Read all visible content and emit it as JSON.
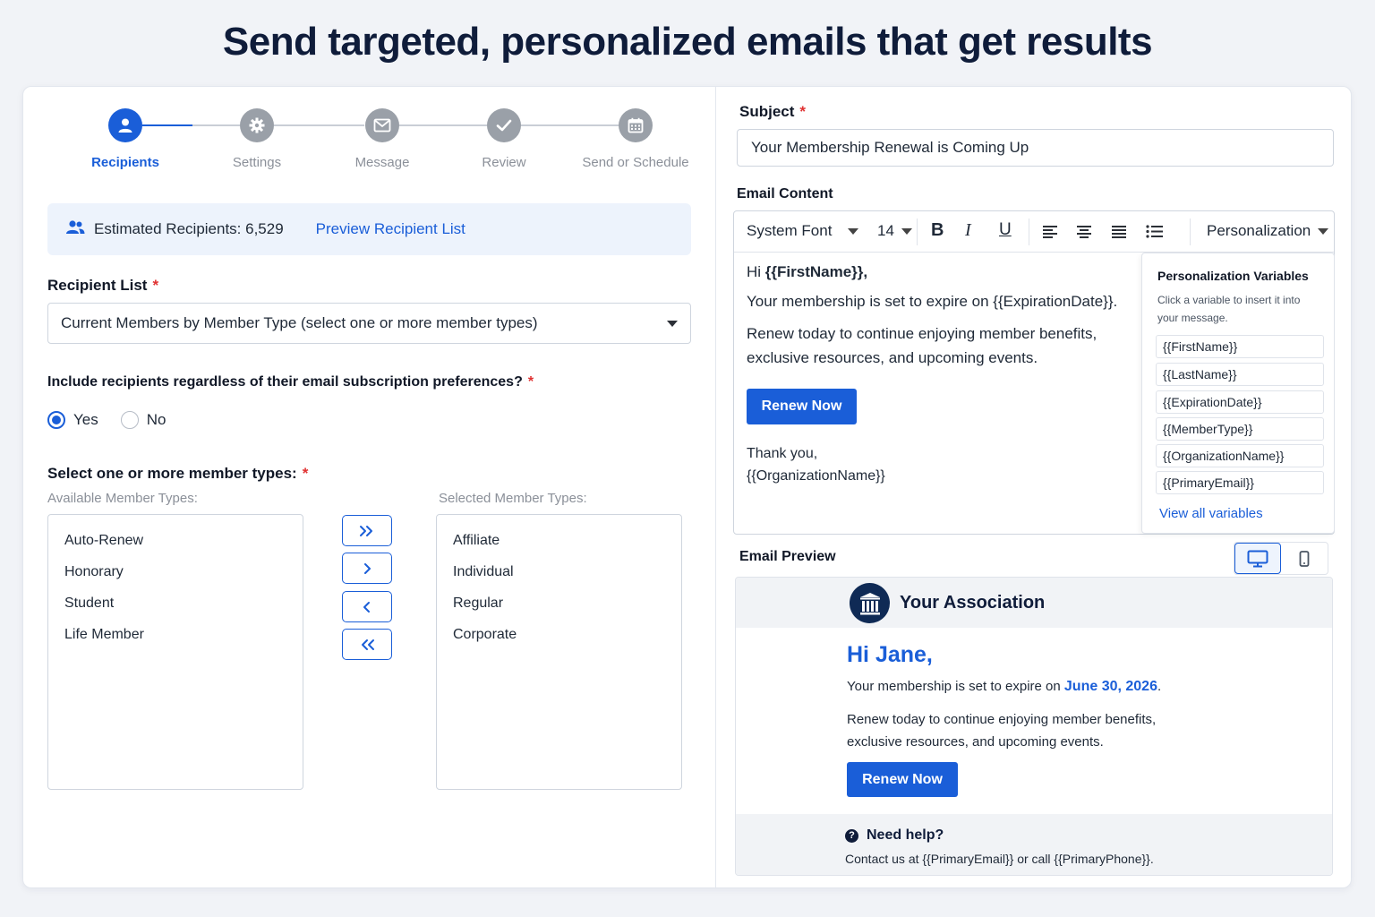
{
  "headline": "Send targeted, personalized emails that get results",
  "stepper": {
    "steps": [
      {
        "label": "Recipients",
        "icon": "user-icon",
        "active": true
      },
      {
        "label": "Settings",
        "icon": "gear-icon",
        "active": false
      },
      {
        "label": "Message",
        "icon": "envelope-icon",
        "active": false
      },
      {
        "label": "Review",
        "icon": "check-icon",
        "active": false
      },
      {
        "label": "Send or Schedule",
        "icon": "calendar-icon",
        "active": false
      }
    ]
  },
  "recipients": {
    "estimated": "Estimated Recipients: 6,529",
    "preview_link": "Preview Recipient List",
    "list_label": "Recipient List",
    "list_value": "Current Members by Member Type (select one or more member types)",
    "subscription_question": "Include recipients regardless of their email subscription preferences?",
    "yes_label": "Yes",
    "no_label": "No",
    "selected_option": "Yes",
    "member_types_label": "Select one or more member types:",
    "available_label": "Available Member Types:",
    "selected_label": "Selected Member Types:",
    "available": [
      "Auto-Renew",
      "Honorary",
      "Student",
      "Life Member"
    ],
    "selected": [
      "Affiliate",
      "Individual",
      "Regular",
      "Corporate"
    ]
  },
  "required_marker": "*",
  "subject": {
    "label": "Subject",
    "value": "Your Membership Renewal is Coming Up"
  },
  "email_content": {
    "label": "Email Content",
    "font": "System Font",
    "size": "14",
    "personalization": "Personalization",
    "greeting_prefix": "Hi ",
    "greeting_var": "{{FirstName}},",
    "line1": "Your membership is set to expire on {{ExpirationDate}}.",
    "line2": "Renew today to continue enjoying member benefits, exclusive resources, and upcoming events.",
    "button": "Renew Now",
    "thanks": "Thank you,",
    "signature": "{{OrganizationName}}"
  },
  "personalization_panel": {
    "title": "Personalization Variables",
    "desc": "Click a variable to insert it into your message.",
    "variables": [
      "{{FirstName}}",
      "{{LastName}}",
      "{{ExpirationDate}}",
      "{{MemberType}}",
      "{{OrganizationName}}",
      "{{PrimaryEmail}}"
    ],
    "view_all": "View all variables"
  },
  "email_preview": {
    "label": "Email Preview",
    "org_name": "Your Association",
    "greeting": "Hi Jane,",
    "line1_prefix": "Your membership is set to expire on ",
    "line1_date": "June 30, 2026",
    "line1_suffix": ".",
    "line2": "Renew today to continue enjoying member benefits, exclusive resources, and upcoming events.",
    "button": "Renew Now",
    "help_title": "Need help?",
    "help_text": "Contact us at {{PrimaryEmail}} or call {{PrimaryPhone}}."
  },
  "colors": {
    "accent": "#1a5ed8",
    "heading": "#0f1c3a",
    "required": "#e03131"
  }
}
